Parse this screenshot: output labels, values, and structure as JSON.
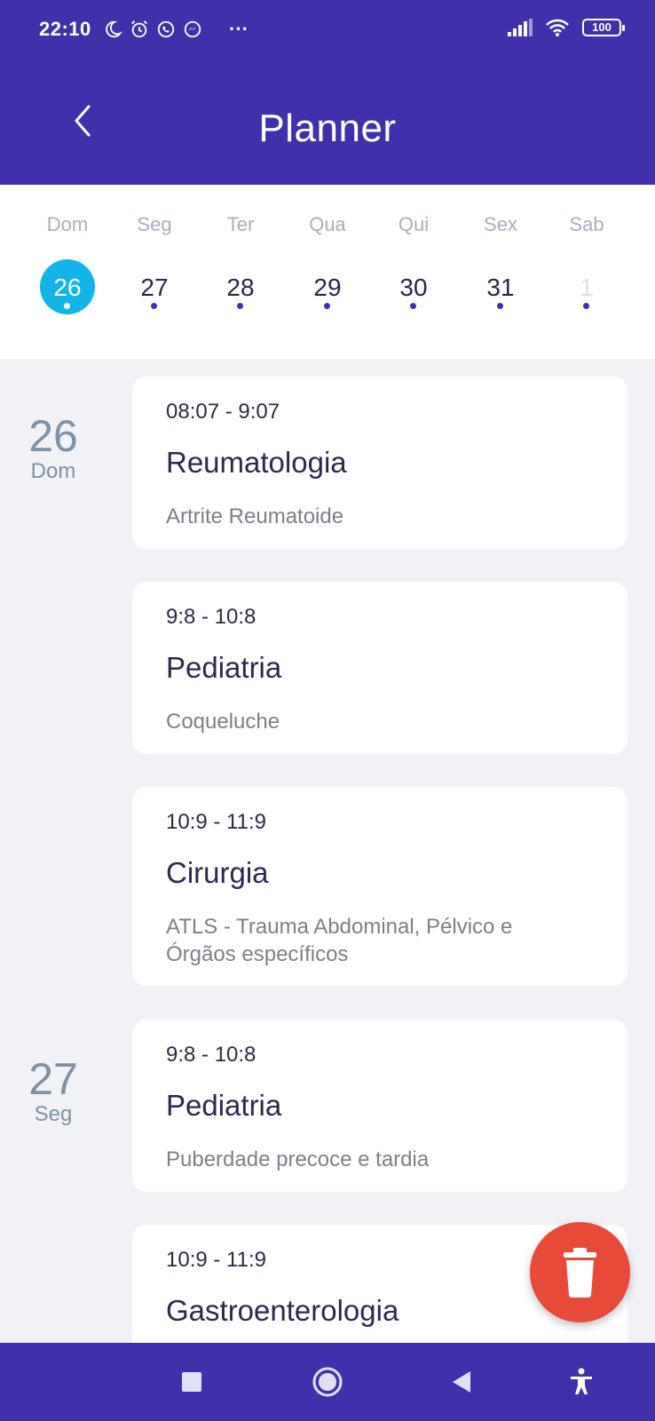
{
  "status_bar": {
    "time": "22:10",
    "more": "···",
    "battery": "100",
    "icons_left": [
      "moon-icon",
      "alarm-icon",
      "whatsapp-icon",
      "messenger-icon"
    ],
    "icons_right": [
      "signal-icon",
      "wifi-icon",
      "battery-icon"
    ]
  },
  "app_bar": {
    "title": "Planner",
    "back_icon": "chevron-left-icon",
    "color": "#4130ac"
  },
  "week": {
    "days": [
      {
        "name": "Dom",
        "num": "26",
        "selected": true,
        "has_events": true
      },
      {
        "name": "Seg",
        "num": "27",
        "selected": false,
        "has_events": true
      },
      {
        "name": "Ter",
        "num": "28",
        "selected": false,
        "has_events": true
      },
      {
        "name": "Qua",
        "num": "29",
        "selected": false,
        "has_events": true
      },
      {
        "name": "Qui",
        "num": "30",
        "selected": false,
        "has_events": true
      },
      {
        "name": "Sex",
        "num": "31",
        "selected": false,
        "has_events": true
      },
      {
        "name": "Sab",
        "num": "1",
        "selected": false,
        "has_events": true,
        "other_month": true
      }
    ],
    "selected_color": "#12b5e8"
  },
  "schedule": {
    "groups": [
      {
        "date_num": "26",
        "date_dow": "Dom",
        "events": [
          {
            "time": "08:07 - 9:07",
            "title": "Reumatologia",
            "subtitle": "Artrite Reumatoide"
          },
          {
            "time": "9:8 - 10:8",
            "title": "Pediatria",
            "subtitle": "Coqueluche"
          },
          {
            "time": "10:9 - 11:9",
            "title": "Cirurgia",
            "subtitle": "ATLS - Trauma Abdominal, Pélvico e Órgãos específicos"
          }
        ]
      },
      {
        "date_num": "27",
        "date_dow": "Seg",
        "events": [
          {
            "time": "9:8 - 10:8",
            "title": "Pediatria",
            "subtitle": "Puberdade precoce e tardia"
          },
          {
            "time": "10:9 - 11:9",
            "title": "Gastroenterologia",
            "subtitle": ""
          }
        ]
      }
    ]
  },
  "fab": {
    "icon": "trash-icon",
    "color": "#e84a3a"
  },
  "nav_bar": {
    "buttons": [
      "recents-square-icon",
      "home-circle-icon",
      "back-triangle-icon",
      "accessibility-icon"
    ]
  }
}
